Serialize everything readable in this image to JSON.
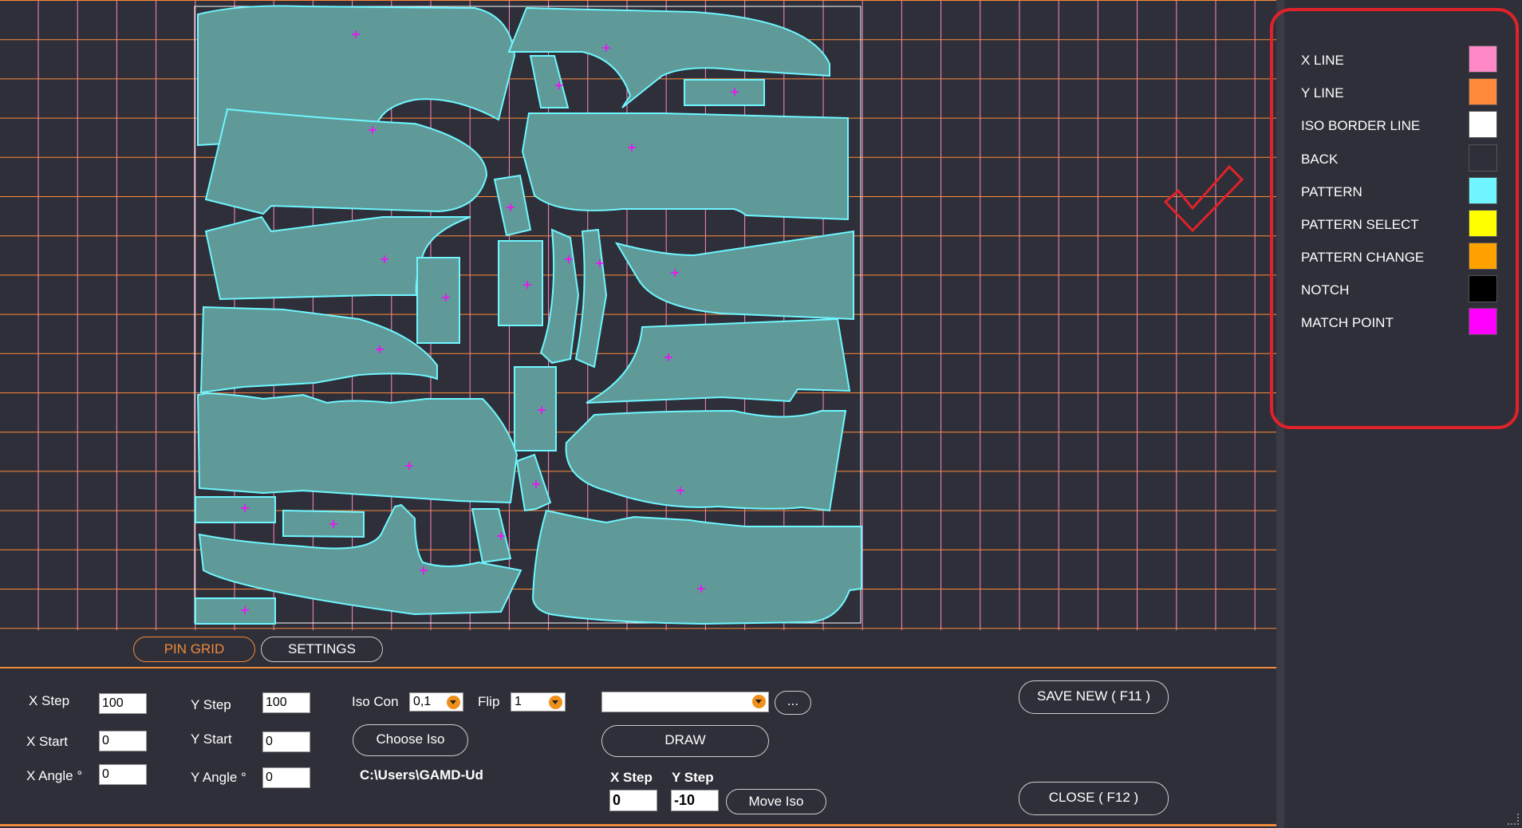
{
  "colors": {
    "background": "#2e2f38",
    "x_line": "#ff88c8",
    "y_line": "#ff8a3c",
    "iso_border": "#ffffff",
    "pattern_fill": "#5f9a98",
    "pattern_stroke": "#6ff6ff",
    "match_point": "#ff00ff",
    "accent": "#f08a3c",
    "highlight_box": "#e0222a"
  },
  "legend": [
    {
      "label": "X LINE",
      "color": "#ff88c8"
    },
    {
      "label": "Y LINE",
      "color": "#ff8a3c"
    },
    {
      "label": "ISO BORDER LINE",
      "color": "#ffffff"
    },
    {
      "label": "BACK",
      "color": "#2e2f38"
    },
    {
      "label": "PATTERN",
      "color": "#6ff6ff"
    },
    {
      "label": "PATTERN SELECT",
      "color": "#ffff00"
    },
    {
      "label": "PATTERN CHANGE",
      "color": "#ffa200"
    },
    {
      "label": "NOTCH",
      "color": "#000000"
    },
    {
      "label": "MATCH POINT",
      "color": "#ff00ff"
    }
  ],
  "tabs": {
    "pin_grid": "PIN GRID",
    "settings": "SETTINGS"
  },
  "form": {
    "x_step_label": "X Step",
    "x_step_value": "100",
    "y_step_label": "Y Step",
    "y_step_value": "100",
    "x_start_label": "X Start",
    "x_start_value": "0",
    "y_start_label": "Y Start",
    "y_start_value": "0",
    "x_angle_label": "X Angle °",
    "x_angle_value": "0",
    "y_angle_label": "Y Angle °",
    "y_angle_value": "0",
    "iso_con_label": "Iso Con",
    "iso_con_value": "0,1",
    "flip_label": "Flip",
    "flip_value": "1",
    "choose_iso_label": "Choose Iso",
    "path_text": "C:\\Users\\GAMD-Ud",
    "file_select_value": "",
    "browse_label": "...",
    "draw_label": "DRAW",
    "move_x_step_label": "X Step",
    "move_x_step_value": "0",
    "move_y_step_label": "Y Step",
    "move_y_step_value": "-10",
    "move_iso_label": "Move Iso",
    "save_label": "SAVE NEW ( F11 )",
    "close_label": "CLOSE ( F12 )"
  }
}
